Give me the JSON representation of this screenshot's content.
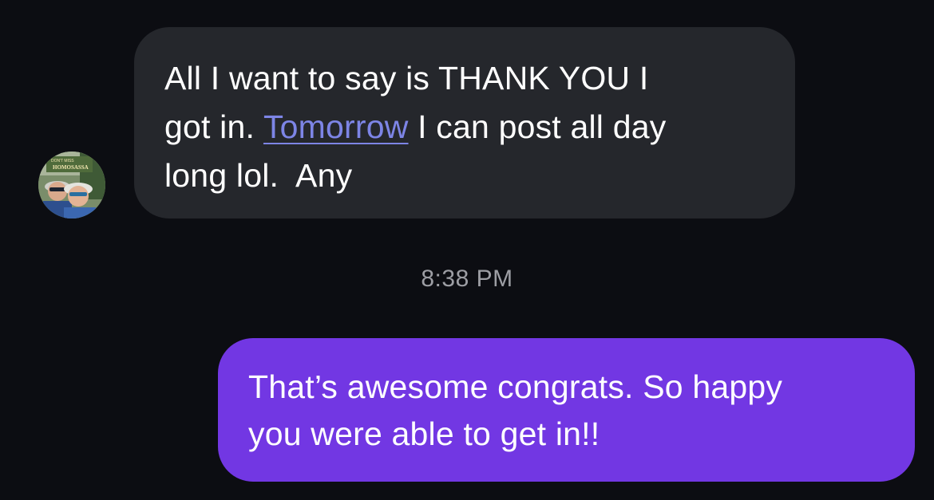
{
  "conversation": {
    "incoming_message": {
      "line1": "All I want to say is THANK YOU I",
      "line2_start": "got in. ",
      "link_text": "Tomorrow",
      "line2_end": " I can post all day",
      "line3": "long lol.  Any"
    },
    "timestamp": "8:38 PM",
    "outgoing_message": {
      "line1": "That’s awesome congrats. So happy",
      "line2": "you were able to get in!!"
    },
    "avatar": {
      "sign_small": "DON'T MISS",
      "sign_big": "HOMOSASSA"
    }
  },
  "colors": {
    "background": "#0c0d12",
    "incoming_bubble": "#25272c",
    "outgoing_bubble": "#7237e3",
    "link": "#7d85e6",
    "timestamp": "#9d9ea4"
  }
}
